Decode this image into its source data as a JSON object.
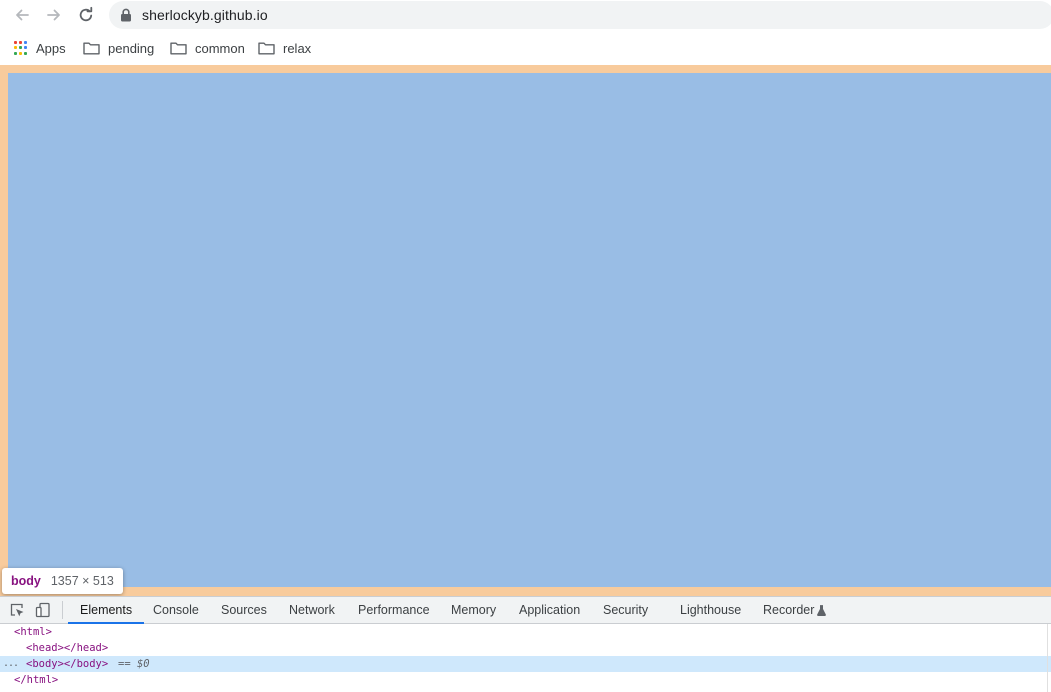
{
  "browser": {
    "url": "sherlockyb.github.io",
    "icons": {
      "back": "arrow-left-icon",
      "forward": "arrow-right-icon",
      "reload": "reload-icon",
      "secure": "lock-icon"
    }
  },
  "bookmarks": [
    {
      "label": "Apps",
      "icon": "apps-grid-icon"
    },
    {
      "label": "pending",
      "icon": "folder-icon"
    },
    {
      "label": "common",
      "icon": "folder-icon"
    },
    {
      "label": "relax",
      "icon": "folder-icon"
    }
  ],
  "page": {
    "colors": {
      "margin_highlight": "#f8cb9c",
      "content_highlight": "#99bde5"
    },
    "inspect_tooltip": {
      "tag": "body",
      "size": "1357 × 513"
    }
  },
  "devtools": {
    "tools": [
      "inspect-element-icon",
      "device-toolbar-icon"
    ],
    "tabs": [
      {
        "label": "Elements",
        "active": true
      },
      {
        "label": "Console"
      },
      {
        "label": "Sources"
      },
      {
        "label": "Network"
      },
      {
        "label": "Performance"
      },
      {
        "label": "Memory"
      },
      {
        "label": "Application"
      },
      {
        "label": "Security"
      },
      {
        "label": "Lighthouse"
      },
      {
        "label": "Recorder",
        "icon": "flask-icon"
      }
    ],
    "dom": {
      "html_open": "<html>",
      "head": "<head></head>",
      "body": "<body></body>",
      "selected_ref": "== $0",
      "html_close": "</html>",
      "ellipsis": "..."
    },
    "colors": {
      "accent": "#1a73e8",
      "selected_row": "#cfe8fc",
      "tag": "#881280"
    }
  }
}
